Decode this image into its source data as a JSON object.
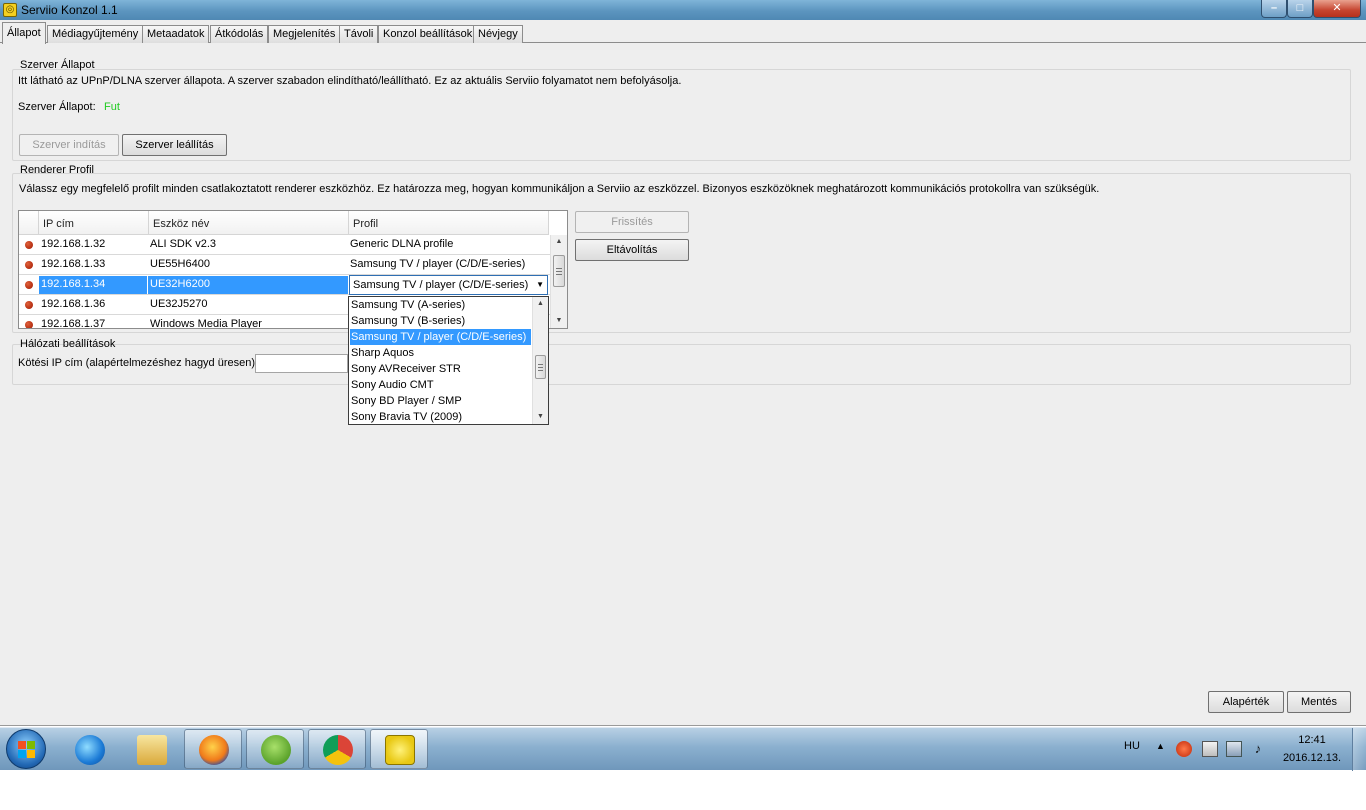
{
  "window": {
    "title": "Serviio Konzol 1.1",
    "controls": {
      "minimize": "–",
      "maximize": "□",
      "close": "✕"
    }
  },
  "tabs": [
    {
      "label": "Állapot",
      "active": true
    },
    {
      "label": "Médiagyűjtemény"
    },
    {
      "label": "Metaadatok"
    },
    {
      "label": "Átkódolás"
    },
    {
      "label": "Megjelenítés"
    },
    {
      "label": "Távoli"
    },
    {
      "label": "Konzol beállítások"
    },
    {
      "label": "Névjegy"
    }
  ],
  "server_status": {
    "title": "Szerver Állapot",
    "description": "Itt látható az UPnP/DLNA szerver állapota. A szerver szabadon elindítható/leállítható. Ez az aktuális Serviio folyamatot nem befolyásolja.",
    "status_label": "Szerver Állapot:",
    "status_value": "Fut",
    "status_color": "#22cc22",
    "start_button": "Szerver indítás",
    "stop_button": "Szerver leállítás"
  },
  "renderer": {
    "title": "Renderer Profil",
    "description": "Válassz egy megfelelő profilt minden csatlakoztatott renderer eszközhöz. Ez határozza meg, hogyan kommunikáljon a Serviio az eszközzel. Bizonyos eszközöknek meghatározott kommunikációs protokollra van szükségük.",
    "columns": [
      "IP cím",
      "Eszköz név",
      "Profil"
    ],
    "rows": [
      {
        "ip": "192.168.1.32",
        "name": "ALI SDK v2.3",
        "profile": "Generic DLNA profile"
      },
      {
        "ip": "192.168.1.33",
        "name": "UE55H6400",
        "profile": "Samsung TV / player (C/D/E-series)"
      },
      {
        "ip": "192.168.1.34",
        "name": "UE32H6200",
        "profile": "Samsung TV / player (C/D/E-series)",
        "selected": true
      },
      {
        "ip": "192.168.1.36",
        "name": "UE32J5270",
        "profile": ""
      },
      {
        "ip": "192.168.1.37",
        "name": "Windows Media Player",
        "profile": ""
      }
    ],
    "refresh_button": "Frissítés",
    "remove_button": "Eltávolítás",
    "dropdown_options": [
      "Samsung TV (A-series)",
      "Samsung TV (B-series)",
      "Samsung TV / player (C/D/E-series)",
      "Sharp Aquos",
      "Sony AVReceiver STR",
      "Sony Audio CMT",
      "Sony BD Player / SMP",
      "Sony Bravia TV (2009)"
    ],
    "dropdown_selected_index": 2
  },
  "network": {
    "title": "Hálózati beállítások",
    "bind_ip_label": "Kötési IP cím (alapértelmezéshez hagyd üresen):",
    "bind_ip_value": ""
  },
  "footer": {
    "defaults_button": "Alapérték",
    "save_button": "Mentés"
  },
  "taskbar": {
    "apps": [
      "internet-explorer",
      "file-explorer",
      "firefox",
      "utorrent",
      "chrome",
      "serviio"
    ],
    "language": "HU",
    "time": "12:41",
    "date": "2016.12.13.",
    "colors": {
      "accent": "#3399ff",
      "status_dot": "#c0280a"
    }
  }
}
